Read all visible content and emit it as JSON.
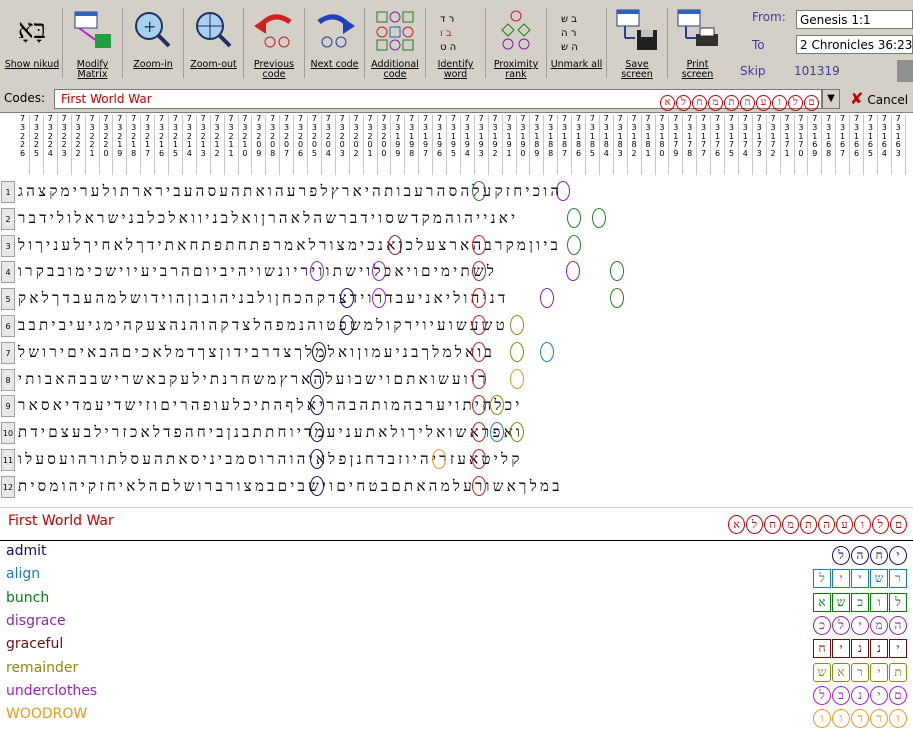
{
  "toolbar": {
    "buttons": [
      {
        "id": "show-nikud",
        "label": "Show nikud",
        "icon": "nikud-icon"
      },
      {
        "id": "modify-matrix",
        "label": "Modify Matrix",
        "icon": "matrix-icon"
      },
      {
        "id": "zoom-in",
        "label": "Zoom-in",
        "icon": "zoom-in-icon"
      },
      {
        "id": "zoom-out",
        "label": "Zoom-out",
        "icon": "zoom-out-icon"
      },
      {
        "id": "previous-code",
        "label": "Previous code",
        "icon": "prev-arrow-icon"
      },
      {
        "id": "next-code",
        "label": "Next code",
        "icon": "next-arrow-icon"
      },
      {
        "id": "additional-code",
        "label": "Additional code",
        "icon": "additional-icon"
      },
      {
        "id": "identify-word",
        "label": "Identify word",
        "icon": "identify-icon"
      },
      {
        "id": "proximity-rank",
        "label": "Proximity rank",
        "icon": "proximity-icon"
      },
      {
        "id": "unmark-all",
        "label": "Unmark all",
        "icon": "unmark-icon"
      },
      {
        "id": "save-screen",
        "label": "Save screen",
        "icon": "floppy-icon"
      },
      {
        "id": "print-screen",
        "label": "Print screen",
        "icon": "printer-icon"
      }
    ],
    "nikud_glyph": "בָּאָ"
  },
  "range": {
    "from_label": "From:",
    "from_value": "Genesis 1:1",
    "to_label": "To",
    "to_value": "2 Chronicles 36:23",
    "skip_label": "Skip",
    "skip_value": "101319"
  },
  "codes": {
    "label": "Codes:",
    "value": "First World War",
    "hebrew_circled": [
      "א",
      "ל",
      "ח",
      "מ",
      "ת",
      "ה",
      "ע",
      "ו",
      "ל",
      "ם"
    ],
    "cancel_label": "Cancel"
  },
  "columns": [
    "7\n3\n2\n2\n6",
    "7\n3\n2\n2\n5",
    "7\n3\n2\n2\n4",
    "7\n3\n2\n2\n3",
    "7\n3\n2\n2\n2",
    "7\n3\n2\n2\n1",
    "7\n3\n2\n2\n0",
    "7\n3\n2\n1\n9",
    "7\n3\n2\n1\n8",
    "7\n3\n2\n1\n7",
    "7\n3\n2\n1\n6",
    "7\n3\n2\n1\n5",
    "7\n3\n2\n1\n4",
    "7\n3\n2\n1\n3",
    "7\n3\n2\n1\n2",
    "7\n3\n2\n1\n1",
    "7\n3\n2\n1\n0",
    "7\n3\n2\n0\n9",
    "7\n3\n2\n0\n8",
    "7\n3\n2\n0\n7",
    "7\n3\n2\n0\n6",
    "7\n3\n2\n0\n5",
    "7\n3\n2\n0\n4",
    "7\n3\n2\n0\n3",
    "7\n3\n2\n0\n2",
    "7\n3\n2\n0\n1",
    "7\n3\n2\n0\n0",
    "7\n3\n1\n9\n9",
    "7\n3\n1\n9\n8",
    "7\n3\n1\n9\n7",
    "7\n3\n1\n9\n6",
    "7\n3\n1\n9\n5",
    "7\n3\n1\n9\n4",
    "7\n3\n1\n9\n3",
    "7\n3\n1\n9\n2",
    "7\n3\n1\n9\n1",
    "7\n3\n1\n9\n0",
    "7\n3\n1\n8\n9",
    "7\n3\n1\n8\n8",
    "7\n3\n1\n8\n7",
    "7\n3\n1\n8\n6",
    "7\n3\n1\n8\n5",
    "7\n3\n1\n8\n4",
    "7\n3\n1\n8\n3",
    "7\n3\n1\n8\n2",
    "7\n3\n1\n8\n1",
    "7\n3\n1\n8\n0",
    "7\n3\n1\n7\n9",
    "7\n3\n1\n7\n8",
    "7\n3\n1\n7\n7",
    "7\n3\n1\n7\n6",
    "7\n3\n1\n7\n5",
    "7\n3\n1\n7\n4",
    "7\n3\n1\n7\n3",
    "7\n3\n1\n7\n2",
    "7\n3\n1\n7\n1",
    "7\n3\n1\n7\n0",
    "7\n3\n1\n6\n9",
    "7\n3\n1\n6\n8",
    "7\n3\n1\n6\n7",
    "7\n3\n1\n6\n6",
    "7\n3\n1\n6\n5",
    "7\n3\n1\n6\n4",
    "7\n3\n1\n6\n3"
  ],
  "rows": [
    {
      "n": "1",
      "text": "הוכיחזקעלהסהרעבותהיארץלפרעהואתהעסהעבירארתולערימקצהג"
    },
    {
      "n": "2",
      "text": "יאנייהוהמקדשסוידברשהלאהרןואלבניוואלכלבנישראלולידבר"
    },
    {
      "n": "3",
      "text": "ביוןמקרבהארצעלכןאנכימצורלאמרפתחתפתחאתידךלאחיךלעניךול"
    },
    {
      "n": "4",
      "text": "לשתימיםויאכלוישתוויריונשויהיביוםהרביעיוישכימובבקרו"
    },
    {
      "n": "5",
      "text": "דניהוליאניעבדרוידצדקהכחןולבניהובוןהוידושלמהעבדךלאק"
    },
    {
      "n": "6",
      "text": "טשעשועיוירקולמשפטוהנמפהלצדקהוהנהצעקהימגיעיביתבב"
    },
    {
      "n": "7",
      "text": "בואלמלךבניעמוןואלמלךצדרבידוןצךדמלאכיםהבאיםירושל"
    },
    {
      "n": "8",
      "text": "רוועשואתםוישבועלהארץמשחרנתילעקבאשרישבבהאבותי"
    },
    {
      "n": "9",
      "text": "יכלחיתויערבהמותהבהריאלףהתיכלעופהריםוזישדיעמדיאסאר"
    },
    {
      "n": "10",
      "text": "ואפראשואליךולאתעניעמדיוחתתבנןביחהפדלאכזרילבעצםידת"
    },
    {
      "n": "11",
      "text": "קליטאעזריהיוזבדחנןפלאיהוהרוסמביניסאתהעסלתורהועסעלו"
    },
    {
      "n": "12",
      "text": "במלךאשורעלמהאתםבטחיםוישביםבמצורברושלםהלאיחזקיהומסית"
    }
  ],
  "term": {
    "name": "First World War",
    "hebrew": [
      "א",
      "ל",
      "ח",
      "מ",
      "ת",
      "ה",
      "ע",
      "ו",
      "ל",
      "ם"
    ],
    "color": "#c00000"
  },
  "legend": [
    {
      "word": "admit",
      "color": "#101060",
      "letters": [
        "ל",
        "ה",
        "ח",
        "י"
      ],
      "shape": "circle"
    },
    {
      "word": "align",
      "color": "#1e7ab8",
      "letters": [
        "ל",
        "י",
        "י",
        "ש",
        "ר"
      ],
      "shape": "box"
    },
    {
      "word": "bunch",
      "color": "#0a7a0a",
      "letters": [
        "א",
        "ש",
        "כ",
        "ו",
        "ל"
      ],
      "shape": "box"
    },
    {
      "word": "disgrace",
      "color": "#8a2a9a",
      "letters": [
        "כ",
        "ל",
        "י",
        "מ",
        "ה"
      ],
      "shape": "circle"
    },
    {
      "word": "graceful",
      "color": "#6a1010",
      "letters": [
        "ח",
        "י",
        "נ",
        "נ",
        "י"
      ],
      "shape": "box"
    },
    {
      "word": "remainder",
      "color": "#8a8a10",
      "letters": [
        "ש",
        "א",
        "ר",
        "י",
        "ת"
      ],
      "shape": "diamond"
    },
    {
      "word": "underclothes",
      "color": "#a020c0",
      "letters": [
        "ל",
        "ב",
        "נ",
        "י",
        "ם"
      ],
      "shape": "circle"
    },
    {
      "word": "WOODROW",
      "color": "#e89a20",
      "letters": [
        "ו",
        "ו",
        "ד",
        "ר",
        "ו"
      ],
      "shape": "circle"
    }
  ]
}
